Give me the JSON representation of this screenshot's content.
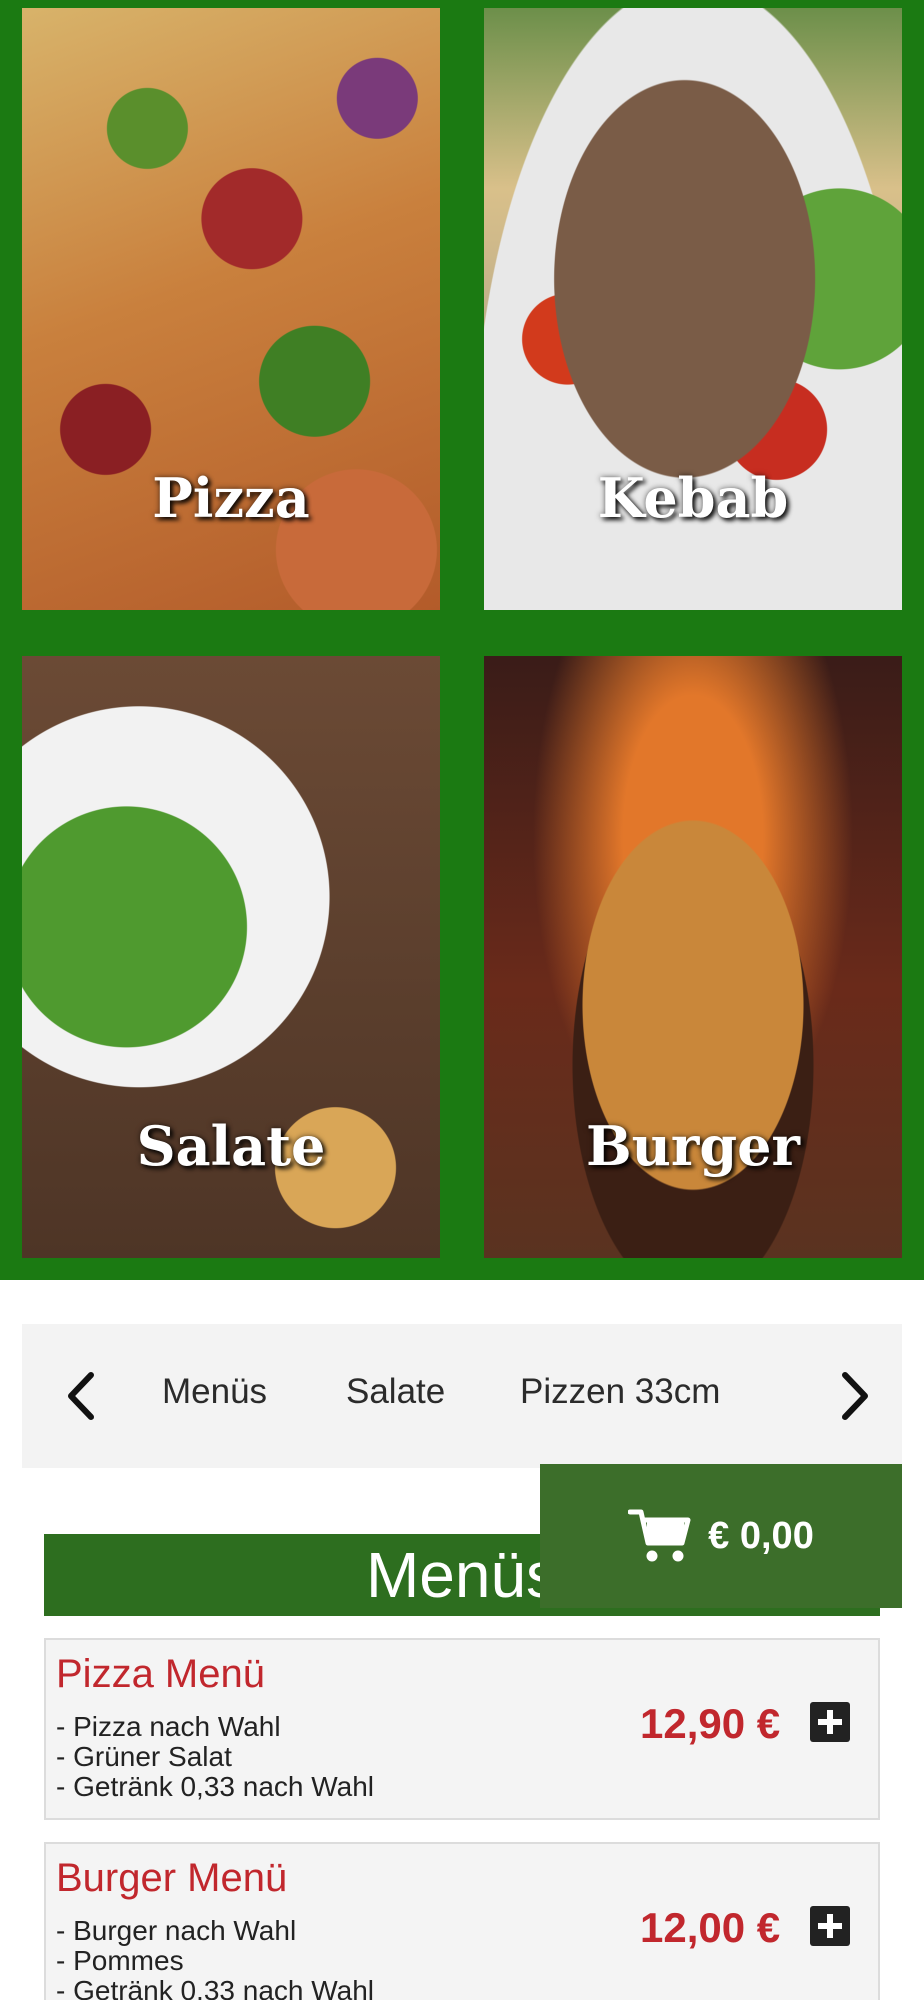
{
  "categories": [
    {
      "label": "Pizza"
    },
    {
      "label": "Kebab"
    },
    {
      "label": "Salate"
    },
    {
      "label": "Burger"
    }
  ],
  "nav": {
    "items": [
      "Menüs",
      "Salate",
      "Pizzen 33cm"
    ],
    "prev_icon": "chevron-left-icon",
    "next_icon": "chevron-right-icon"
  },
  "cart": {
    "icon": "shopping-cart-icon",
    "total": "€ 0,00"
  },
  "section": {
    "title": "Menüs"
  },
  "menu_items": [
    {
      "name": "Pizza Menü",
      "lines": [
        "- Pizza nach Wahl",
        "- Grüner Salat",
        "- Getränk 0,33 nach Wahl"
      ],
      "price": "12,90 €"
    },
    {
      "name": "Burger Menü",
      "lines": [
        "- Burger nach Wahl",
        "- Pommes",
        "- Getränk 0,33 nach Wahl"
      ],
      "price": "12,00 €"
    }
  ],
  "colors": {
    "grid_background": "#1b7a12",
    "cart_background": "#3c6e2a",
    "heading_background": "#2d6e1f",
    "price": "#c1272d"
  }
}
